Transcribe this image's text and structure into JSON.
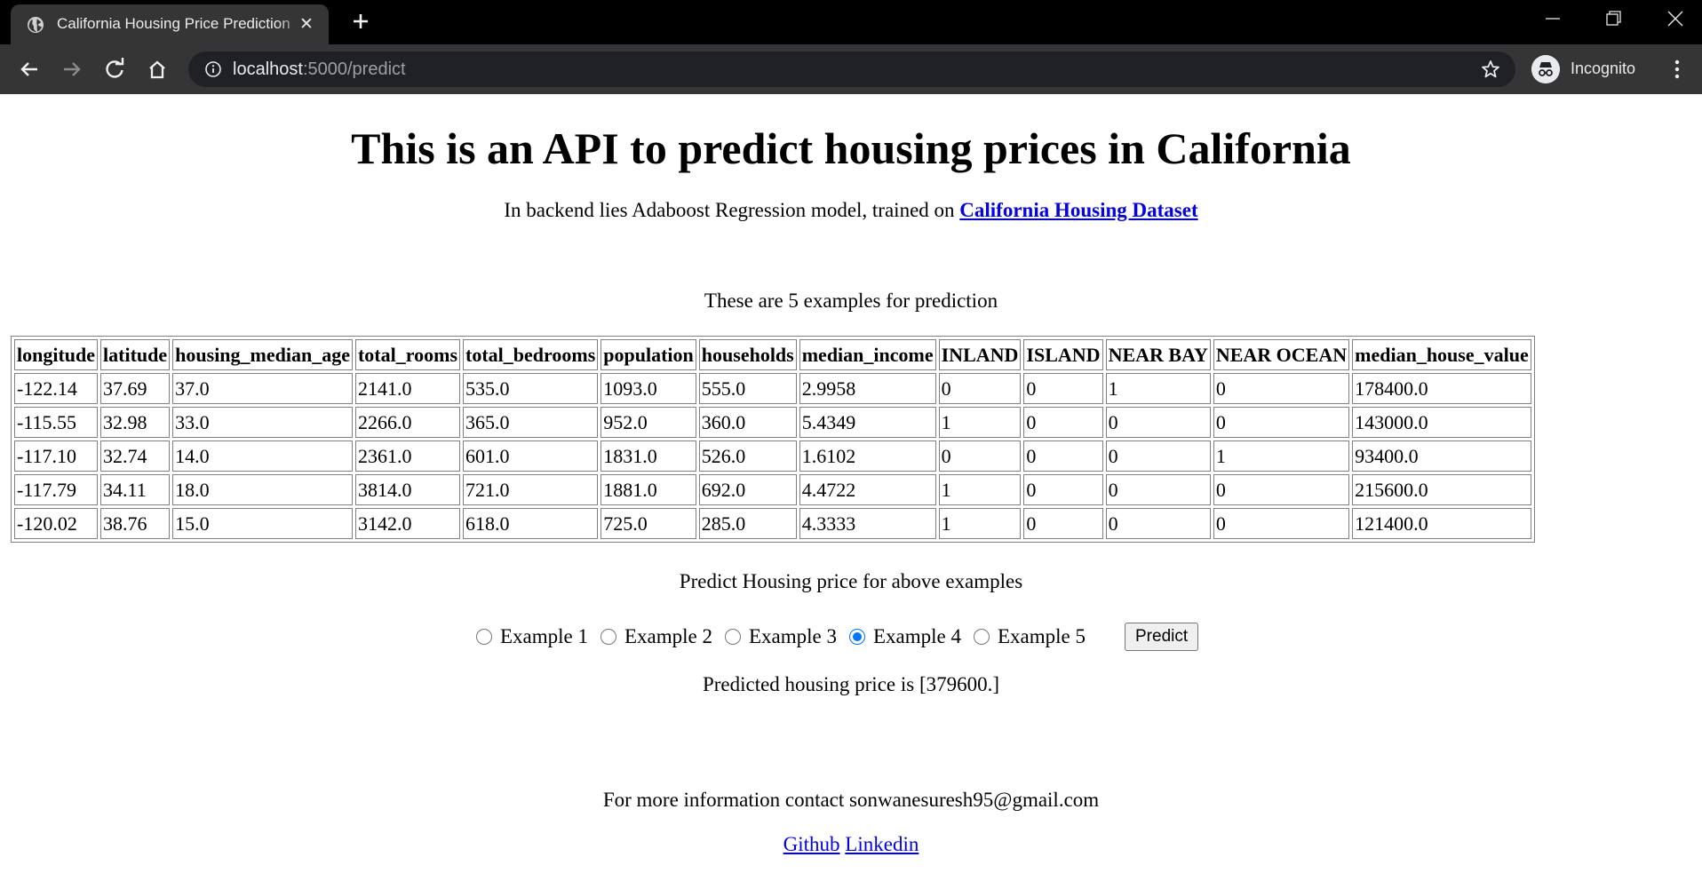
{
  "browser": {
    "tab_title": "California Housing Price Prediction",
    "url_host": "localhost",
    "url_rest": ":5000/predict",
    "profile_label": "Incognito"
  },
  "page": {
    "heading": "This is an API to predict housing prices in California",
    "subtitle_prefix": "In backend lies Adaboost Regression model, trained on ",
    "subtitle_link": "California Housing Dataset",
    "examples_caption": "These are 5 examples for prediction",
    "table": {
      "columns": [
        "longitude",
        "latitude",
        "housing_median_age",
        "total_rooms",
        "total_bedrooms",
        "population",
        "households",
        "median_income",
        "INLAND",
        "ISLAND",
        "NEAR BAY",
        "NEAR OCEAN",
        "median_house_value"
      ],
      "rows": [
        [
          "-122.14",
          "37.69",
          "37.0",
          "2141.0",
          "535.0",
          "1093.0",
          "555.0",
          "2.9958",
          "0",
          "0",
          "1",
          "0",
          "178400.0"
        ],
        [
          "-115.55",
          "32.98",
          "33.0",
          "2266.0",
          "365.0",
          "952.0",
          "360.0",
          "5.4349",
          "1",
          "0",
          "0",
          "0",
          "143000.0"
        ],
        [
          "-117.10",
          "32.74",
          "14.0",
          "2361.0",
          "601.0",
          "1831.0",
          "526.0",
          "1.6102",
          "0",
          "0",
          "0",
          "1",
          "93400.0"
        ],
        [
          "-117.79",
          "34.11",
          "18.0",
          "3814.0",
          "721.0",
          "1881.0",
          "692.0",
          "4.4722",
          "1",
          "0",
          "0",
          "0",
          "215600.0"
        ],
        [
          "-120.02",
          "38.76",
          "15.0",
          "3142.0",
          "618.0",
          "725.0",
          "285.0",
          "4.3333",
          "1",
          "0",
          "0",
          "0",
          "121400.0"
        ]
      ]
    },
    "predict_caption": "Predict Housing price for above examples",
    "radio_options": [
      "Example 1",
      "Example 2",
      "Example 3",
      "Example 4",
      "Example 5"
    ],
    "selected_example": "Example 4",
    "predict_button": "Predict",
    "result": "Predicted housing price is [379600.]",
    "contact": "For more information contact sonwanesuresh95@gmail.com",
    "links": [
      "Github",
      "Linkedin"
    ]
  },
  "colors": {
    "link": "#0000ee",
    "radio_checked": "#0075ff",
    "tab_active": "#353535",
    "titlebar": "#000000"
  }
}
